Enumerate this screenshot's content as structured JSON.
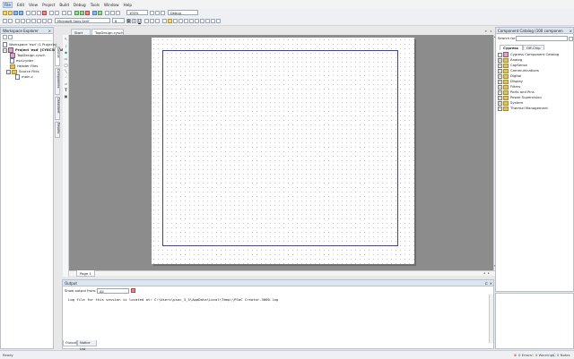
{
  "menu": [
    "File",
    "Edit",
    "View",
    "Project",
    "Build",
    "Debug",
    "Tools",
    "Window",
    "Help"
  ],
  "toolbar": {
    "zoom": "100%",
    "config": "Debug",
    "font": "Microsoft Sans Serif",
    "font_size": "8"
  },
  "workspace": {
    "title": "Workspace Explorer",
    "side_tabs": [
      "Source",
      "Components",
      "Datasheet",
      "Results"
    ],
    "items": [
      {
        "label": "Workspace 'esd' (1 Projects)",
        "icon": "workspace-icon",
        "indent": 0
      },
      {
        "label": "Project 'esd' [CY8C3866A",
        "icon": "project-icon",
        "indent": 1
      },
      {
        "label": "TopDesign.cysch",
        "icon": "schematic-icon",
        "indent": 2
      },
      {
        "label": "esd.cydwr",
        "icon": "document-icon",
        "indent": 2
      },
      {
        "label": "Header Files",
        "icon": "folder-icon",
        "indent": 2
      },
      {
        "label": "Source Files",
        "icon": "folder-icon",
        "indent": 2
      },
      {
        "label": "main.c",
        "icon": "c-file-icon",
        "indent": 3
      }
    ]
  },
  "editor": {
    "tabs": [
      "Start Page",
      "TopDesign.cysch"
    ],
    "active_tab": "TopDesign.cysch",
    "page_tab": "Page 1"
  },
  "output": {
    "title": "Output",
    "show_label": "Show output from:",
    "show_value": "All",
    "log_line": "Log file for this session is located at: C:\\Users\\psoc_3_5\\AppData\\Local\\Temp\\\\PSoC Creator-3000.log",
    "tabs": [
      "Output",
      "Notice List"
    ]
  },
  "catalog": {
    "title": "Component Catalog (100 componen",
    "search_label": "Search for",
    "tabs": [
      "Cypress",
      "Off-Chip"
    ],
    "items": [
      {
        "label": "Cypress Component Catalog",
        "icon": "catalog-icon",
        "indent": 0
      },
      {
        "label": "Analog",
        "icon": "folder-icon",
        "indent": 1
      },
      {
        "label": "CapSense",
        "icon": "folder-icon",
        "indent": 1
      },
      {
        "label": "Communications",
        "icon": "folder-icon",
        "indent": 1
      },
      {
        "label": "Digital",
        "icon": "folder-icon",
        "indent": 1
      },
      {
        "label": "Display",
        "icon": "folder-icon",
        "indent": 1
      },
      {
        "label": "Filters",
        "icon": "folder-icon",
        "indent": 1
      },
      {
        "label": "Ports and Pins",
        "icon": "folder-icon",
        "indent": 1
      },
      {
        "label": "Power Supervision",
        "icon": "folder-icon",
        "indent": 1
      },
      {
        "label": "System",
        "icon": "folder-icon",
        "indent": 1
      },
      {
        "label": "Thermal Management",
        "icon": "folder-icon",
        "indent": 1
      }
    ]
  },
  "status": {
    "text": "Ready",
    "errors": "0 Errors",
    "warnings": "0 Warnings",
    "notes": "0 Notes"
  },
  "colors": {
    "accent": "#2a70d6",
    "frame": "#3c3fb8",
    "canvas_bg": "#8c8c8c"
  }
}
